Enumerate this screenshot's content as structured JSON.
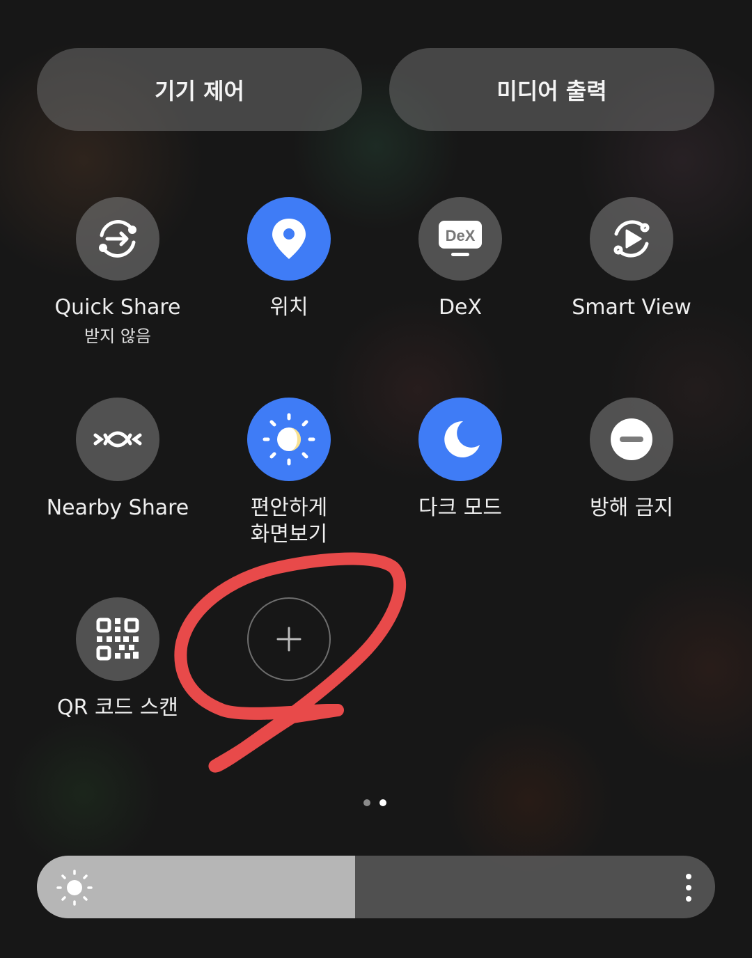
{
  "top_buttons": {
    "device_control": "기기 제어",
    "media_output": "미디어 출력"
  },
  "tiles": [
    {
      "label": "Quick Share",
      "sub": "받지 않음",
      "icon": "quick-share-icon",
      "state": "off"
    },
    {
      "label": "위치",
      "sub": "",
      "icon": "location-pin-icon",
      "state": "on"
    },
    {
      "label": "DeX",
      "sub": "",
      "icon": "dex-icon",
      "icon_text": "DeX",
      "state": "off"
    },
    {
      "label": "Smart View",
      "sub": "",
      "icon": "smart-view-icon",
      "state": "off"
    },
    {
      "label": "Nearby Share",
      "sub": "",
      "icon": "nearby-share-icon",
      "state": "off"
    },
    {
      "label": "편안하게",
      "label_line2": "화면보기",
      "icon": "eye-comfort-icon",
      "state": "on"
    },
    {
      "label": "다크 모드",
      "sub": "",
      "icon": "moon-icon",
      "state": "on"
    },
    {
      "label": "방해 금지",
      "sub": "",
      "icon": "do-not-disturb-icon",
      "state": "off"
    },
    {
      "label": "QR 코드 스캔",
      "sub": "",
      "icon": "qr-code-icon",
      "state": "off"
    }
  ],
  "add_button": {
    "icon": "plus-icon"
  },
  "page_indicator": {
    "pages": 2,
    "current": 2
  },
  "brightness": {
    "level": 0.469,
    "icon": "sun-icon",
    "more_icon": "more-vertical-icon"
  },
  "colors": {
    "accent": "#3f7cf6",
    "annotation": "#e84a4a"
  }
}
